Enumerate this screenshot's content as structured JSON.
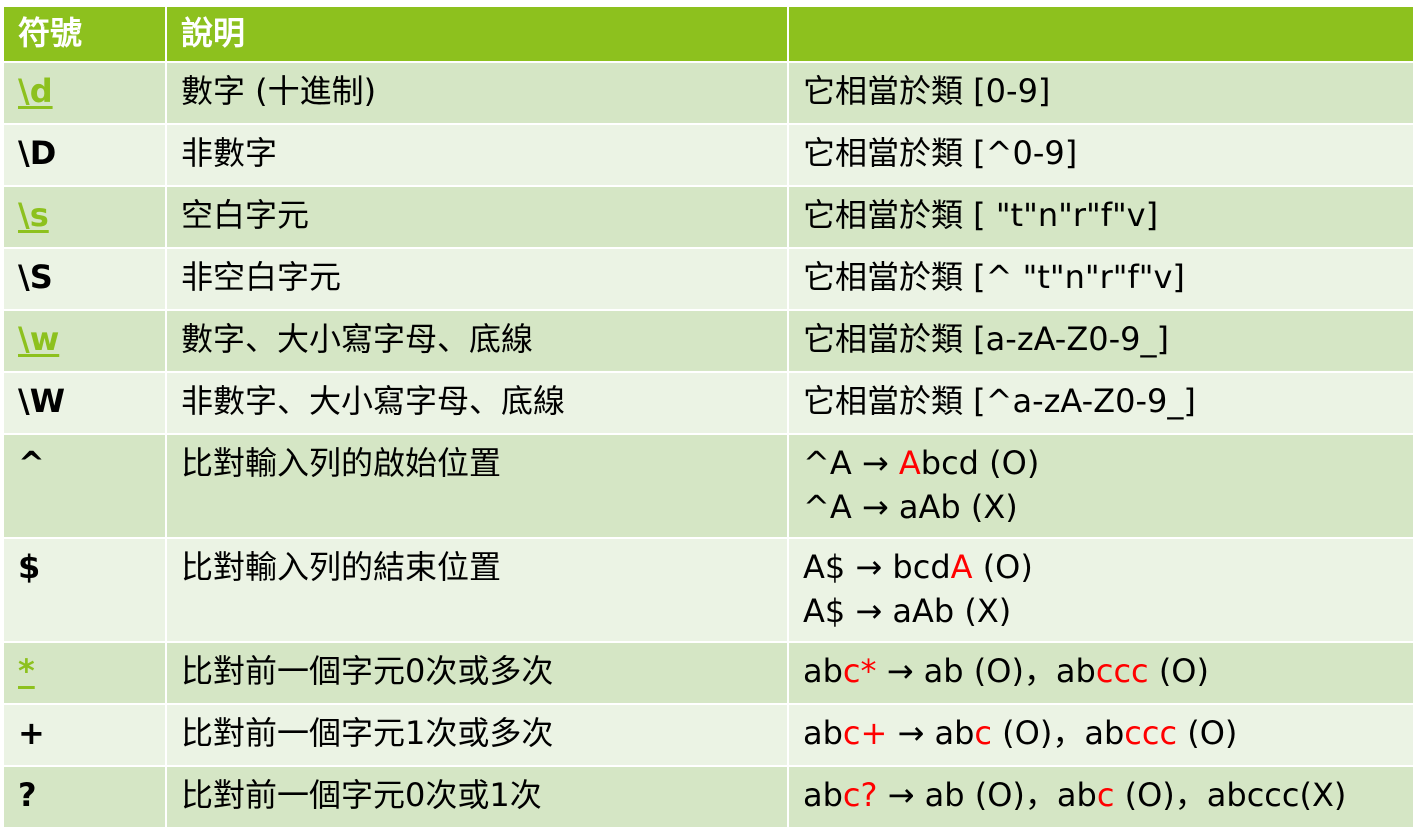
{
  "headers": [
    "符號",
    "說明",
    ""
  ],
  "rows": [
    {
      "symbol": "\\d",
      "desc": "數字 (十進制)",
      "ex": [
        "它相當於類 [0-9]"
      ]
    },
    {
      "symbol": "\\D",
      "desc": "非數字",
      "ex": [
        "它相當於類 [^0-9]"
      ]
    },
    {
      "symbol": "\\s",
      "desc": "空白字元",
      "ex": [
        "它相當於類  [ \"t\"n\"r\"f\"v]"
      ]
    },
    {
      "symbol": "\\S",
      "desc": "非空白字元",
      "ex": [
        "它相當於類 [^ \"t\"n\"r\"f\"v]"
      ]
    },
    {
      "symbol": "\\w",
      "desc": "數字、大小寫字母、底線",
      "ex": [
        "它相當於類 [a-zA-Z0-9_]"
      ]
    },
    {
      "symbol": "\\W",
      "desc": "非數字、大小寫字母、底線",
      "ex": [
        "它相當於類 [^a-zA-Z0-9_]"
      ]
    },
    {
      "symbol": "^",
      "desc": "比對輸入列的啟始位置",
      "ex": [
        [
          "^A → ",
          "A",
          "bcd (O)"
        ],
        [
          "^A → aAb (X)"
        ]
      ]
    },
    {
      "symbol": "$",
      "desc": "比對輸入列的結束位置",
      "ex": [
        [
          "A$ → bcd",
          "A",
          " (O)"
        ],
        [
          "A$ → aAb (X)"
        ]
      ]
    },
    {
      "symbol": "*",
      "desc": "比對前一個字元0次或多次",
      "ex": [
        [
          "ab",
          "c*",
          " → ab (O)，ab",
          "ccc",
          " (O)"
        ]
      ]
    },
    {
      "symbol": "+",
      "desc": "比對前一個字元1次或多次",
      "ex": [
        [
          "ab",
          "c+",
          " → ab",
          "c",
          " (O)，ab",
          "ccc",
          " (O)"
        ]
      ]
    },
    {
      "symbol": "?",
      "desc": "比對前一個字元0次或1次",
      "ex": [
        [
          "ab",
          "c?",
          " → ab (O)，ab",
          "c",
          " (O)，abccc(X)"
        ]
      ]
    }
  ],
  "colors": {
    "header": "#8dc11e",
    "row_odd": "#d5e6c5",
    "row_even": "#ebf3e4",
    "link": "#8dc11e",
    "highlight": "#ff0000"
  }
}
